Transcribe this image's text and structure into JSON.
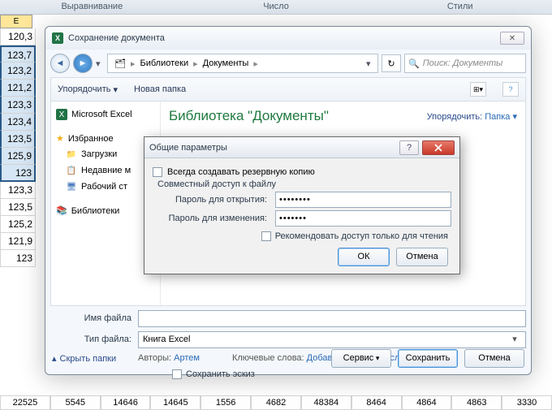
{
  "ribbon": {
    "align": "Выравнивание",
    "number": "Число",
    "styles": "Стили"
  },
  "sheet": {
    "col": "E",
    "cells": [
      "120,3",
      "123,7",
      "123,2",
      "121,2",
      "123,3",
      "123,4",
      "123,5",
      "125,9",
      "123",
      "123,3",
      "123,5",
      "125,2",
      "121,9",
      "123"
    ],
    "bottom": [
      "22525",
      "5545",
      "14646",
      "14645",
      "1556",
      "4682",
      "48384",
      "8464",
      "4864",
      "4863",
      "3330"
    ]
  },
  "save": {
    "title": "Сохранение документа",
    "close": "✕",
    "bc": {
      "lib": "Библиотеки",
      "doc": "Документы"
    },
    "search_ph": "Поиск: Документы",
    "organize": "Упорядочить",
    "newfolder": "Новая папка"
  },
  "sidebar": {
    "app": "Microsoft Excel",
    "fav": "Избранное",
    "downloads": "Загрузки",
    "recent": "Недавние м",
    "desktop": "Рабочий ст",
    "libs": "Библиотеки"
  },
  "main": {
    "libtitle": "Библиотека \"Документы\"",
    "arrange": "Упорядочить:",
    "arrange_val": "Папка"
  },
  "file": {
    "name_lab": "Имя файла",
    "type_lab": "Тип файла:",
    "type_val": "Книга Excel",
    "authors_lab": "Авторы:",
    "authors_val": "Артем",
    "tags_lab": "Ключевые слова:",
    "tags_val": "Добавьте ключевое слово",
    "thumb": "Сохранить эскиз"
  },
  "footer": {
    "hide": "Скрыть папки",
    "tools": "Сервис",
    "save": "Сохранить",
    "cancel": "Отмена"
  },
  "params": {
    "title": "Общие параметры",
    "backup": "Всегда создавать резервную копию",
    "share": "Совместный доступ к файлу",
    "pw_open": "Пароль для открытия:",
    "pw_mod": "Пароль для изменения:",
    "pw_open_val": "••••••••",
    "pw_mod_val": "•••••••",
    "readonly": "Рекомендовать доступ только для чтения",
    "ok": "ОК",
    "cancel": "Отмена"
  }
}
